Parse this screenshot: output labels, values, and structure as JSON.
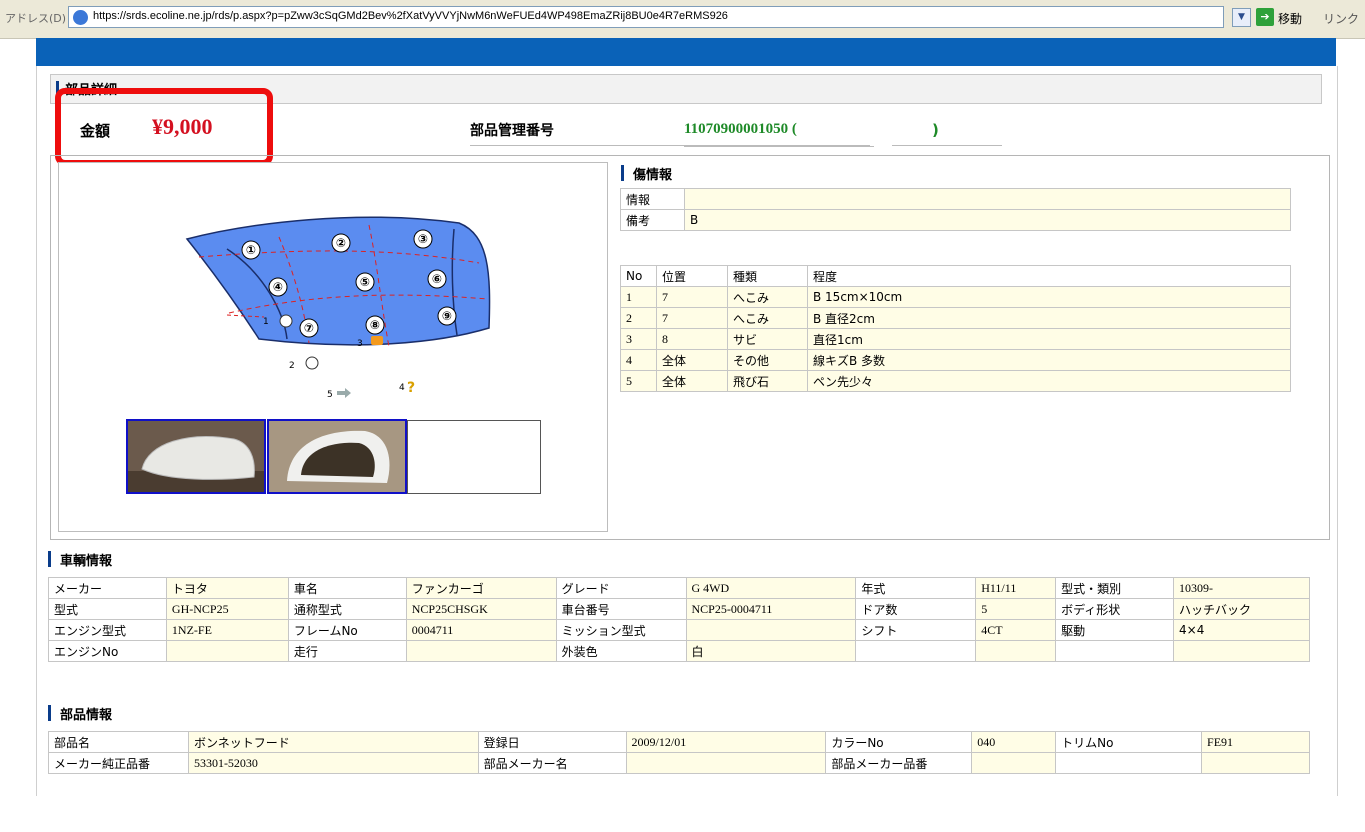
{
  "addressbar": {
    "label": "アドレス(D)",
    "url": "https://srds.ecoline.ne.jp/rds/p.aspx?p=pZww3cSqGMd2Bev%2fXatVyVVYjNwM6nWeFUEd4WP498EmaZRij8BU0e4R7eRMS926",
    "go_label": "移動",
    "links_label": "リンク"
  },
  "section": {
    "title": "部品詳細"
  },
  "price": {
    "label": "金額",
    "value": "¥9,000"
  },
  "management": {
    "label": "部品管理番号",
    "value": "11070900001050 (",
    "close": ")"
  },
  "diagram": {
    "panel_numbers": [
      "①",
      "②",
      "③",
      "④",
      "⑤",
      "⑥",
      "⑦",
      "⑧",
      "⑨"
    ],
    "damage_marker_labels": [
      "1",
      "2",
      "3",
      "4",
      "5"
    ]
  },
  "damage_info": {
    "title": "傷情報",
    "info_label": "情報",
    "info_value": "",
    "remarks_label": "備考",
    "remarks_value": "B",
    "columns": [
      "No",
      "位置",
      "種類",
      "程度"
    ],
    "rows": [
      [
        "1",
        "7",
        "へこみ",
        "B  15cm×10cm"
      ],
      [
        "2",
        "7",
        "へこみ",
        "B  直径2cm"
      ],
      [
        "3",
        "8",
        "サビ",
        "  直径1cm"
      ],
      [
        "4",
        "全体",
        "その他",
        "線キズB  多数"
      ],
      [
        "5",
        "全体",
        "飛び石",
        "ペン先少々"
      ]
    ]
  },
  "vehicle_info": {
    "title": "車輌情報",
    "rows": [
      [
        "メーカー",
        "トヨタ",
        "車名",
        "ファンカーゴ",
        "グレード",
        "G 4WD",
        "年式",
        "H11/11",
        "型式・類別",
        "10309-"
      ],
      [
        "型式",
        "GH-NCP25",
        "通称型式",
        "NCP25CHSGK",
        "車台番号",
        "NCP25-0004711",
        "ドア数",
        "5",
        "ボディ形状",
        "ハッチバック"
      ],
      [
        "エンジン型式",
        "1NZ-FE",
        "フレームNo",
        "0004711",
        "ミッション型式",
        "",
        "シフト",
        "4CT",
        "駆動",
        "4×4"
      ],
      [
        "エンジンNo",
        "",
        "走行",
        "",
        "外装色",
        "白",
        "",
        "",
        "",
        ""
      ]
    ]
  },
  "parts_info": {
    "title": "部品情報",
    "rows": [
      [
        "部品名",
        "ボンネットフード",
        "登録日",
        "2009/12/01",
        "カラーNo",
        "040",
        "トリムNo",
        "FE91"
      ],
      [
        "メーカー純正品番",
        "53301-52030",
        "部品メーカー名",
        "",
        "部品メーカー品番",
        "",
        "",
        ""
      ]
    ]
  },
  "colors": {
    "accent_bar": "#0a62b8",
    "price_red": "#d41020",
    "highlight_box": "#ee0d0d",
    "mgmt_green": "#1e8a28",
    "cell_yellow": "#fffde6",
    "hood_blue": "#5b8cf0"
  }
}
